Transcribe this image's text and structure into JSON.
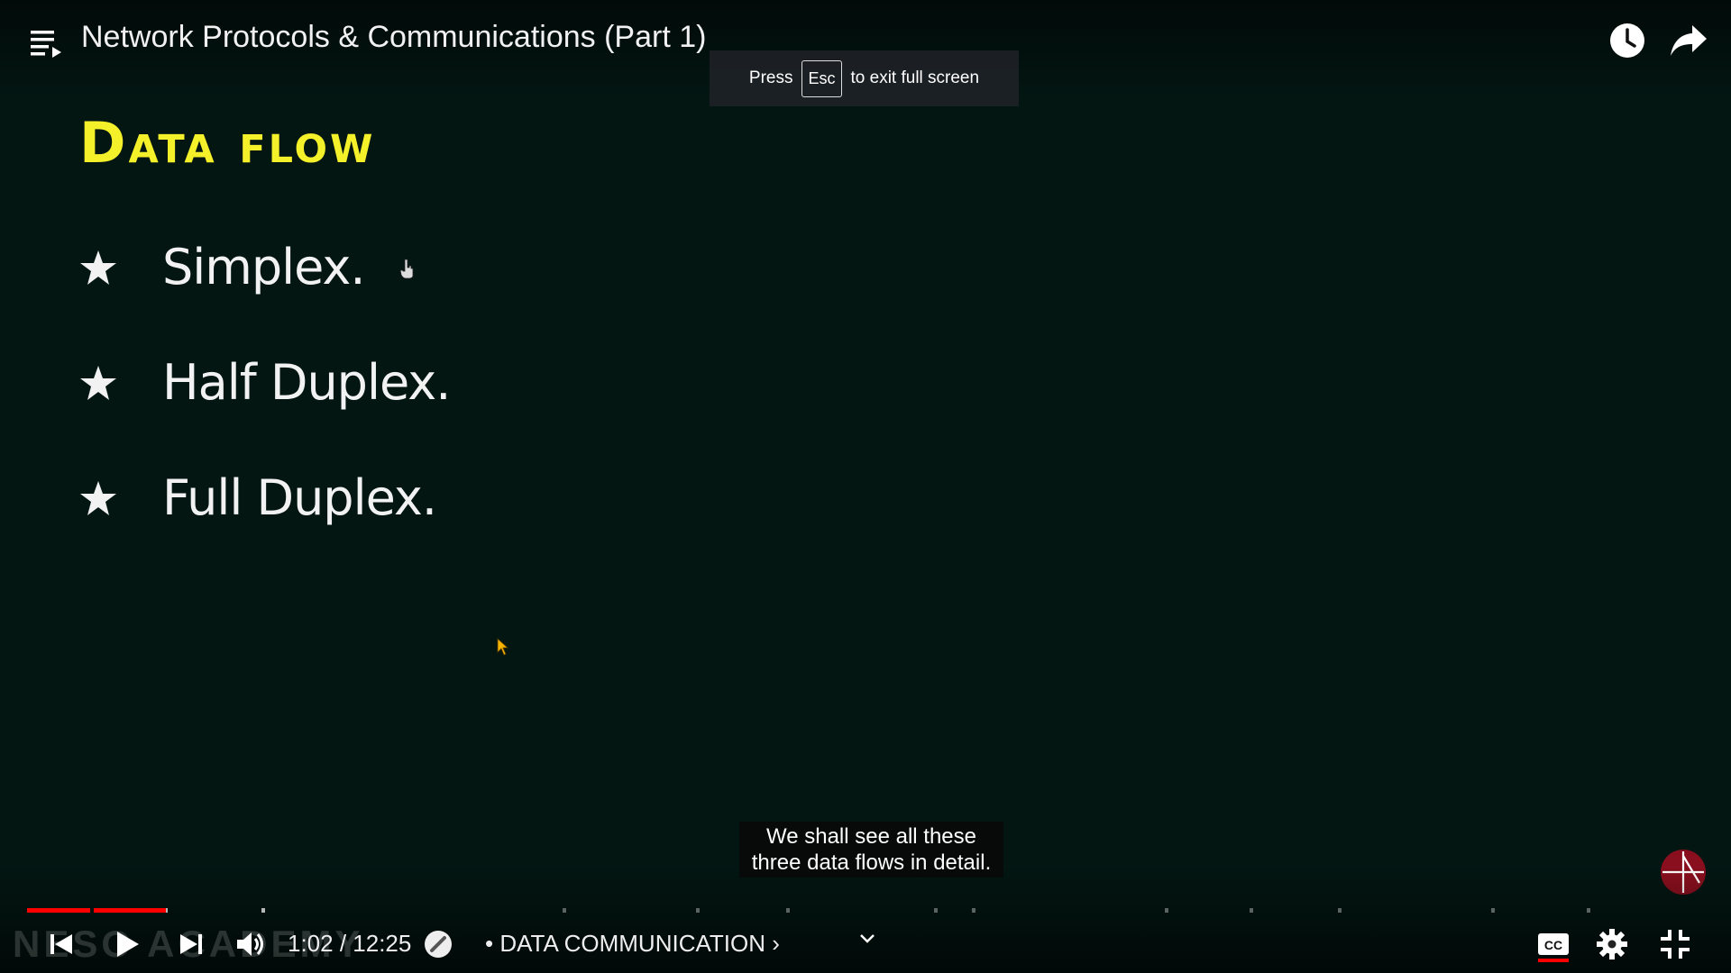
{
  "player": {
    "title": "Network Protocols & Communications (Part 1)",
    "esc_toast": {
      "before": "Press",
      "key": "Esc",
      "after": "to exit full screen"
    },
    "caption": {
      "line1": "We shall see all these",
      "line2": "three data flows in detail."
    },
    "watermark": "NESO ACADEMY",
    "time_display": "1:02 / 12:25",
    "chapter": "• DATA COMMUNICATION ›",
    "progress_fraction": 0.083,
    "colors": {
      "progress_played": "#ff0000",
      "title_yellow": "#f4f02a",
      "background": "#031612"
    }
  },
  "slide": {
    "title": "Data flow",
    "bullets": [
      "Simplex.",
      "Half Duplex.",
      "Full Duplex."
    ]
  },
  "icons": [
    "playlist-icon",
    "watch-later-icon",
    "share-icon",
    "previous-icon",
    "play-icon",
    "next-icon",
    "volume-icon",
    "autoplay-icon",
    "chevron-down-icon",
    "captions-icon",
    "settings-icon",
    "exit-fullscreen-icon"
  ]
}
